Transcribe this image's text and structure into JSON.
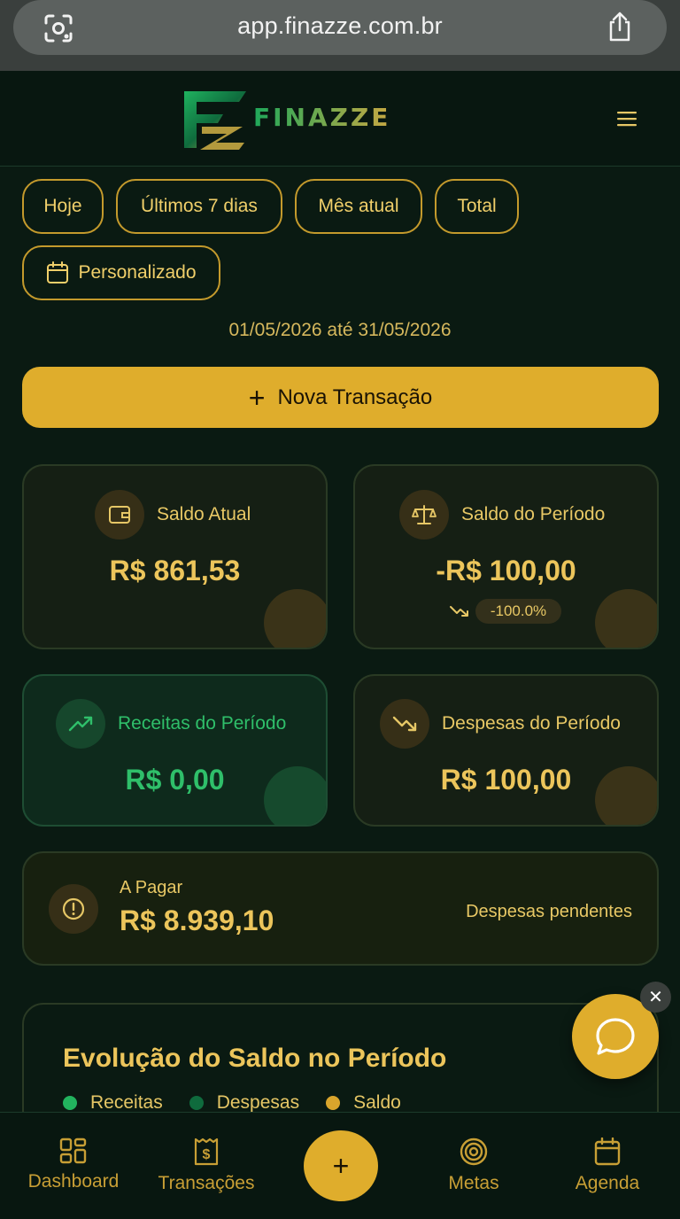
{
  "browser": {
    "url": "app.finazze.com.br"
  },
  "header": {
    "brand": "FINAZZE"
  },
  "filters": {
    "chips": [
      "Hoje",
      "Últimos 7 dias",
      "Mês atual",
      "Total"
    ],
    "custom_label": "Personalizado",
    "date_range": "01/05/2026 até 31/05/2026"
  },
  "actions": {
    "new_transaction": "Nova Transação"
  },
  "cards": {
    "saldo_atual": {
      "title": "Saldo Atual",
      "value": "R$ 861,53"
    },
    "saldo_periodo": {
      "title": "Saldo do Período",
      "value": "-R$ 100,00",
      "change": "-100.0%"
    },
    "receitas": {
      "title": "Receitas do Período",
      "value": "R$ 0,00"
    },
    "despesas": {
      "title": "Despesas do Período",
      "value": "R$ 100,00"
    }
  },
  "pay": {
    "label": "A Pagar",
    "value": "R$ 8.939,10",
    "note": "Despesas pendentes"
  },
  "chart": {
    "title": "Evolução do Saldo no Período",
    "legend": [
      {
        "label": "Receitas",
        "color": "#22b35e"
      },
      {
        "label": "Despesas",
        "color": "#0f6b3d"
      },
      {
        "label": "Saldo",
        "color": "#d9a52c"
      }
    ]
  },
  "nav": {
    "dashboard": "Dashboard",
    "transacoes": "Transações",
    "metas": "Metas",
    "agenda": "Agenda"
  },
  "colors": {
    "accent": "#dfad2c",
    "background": "#0a1a12",
    "positive": "#2fbf6a"
  }
}
